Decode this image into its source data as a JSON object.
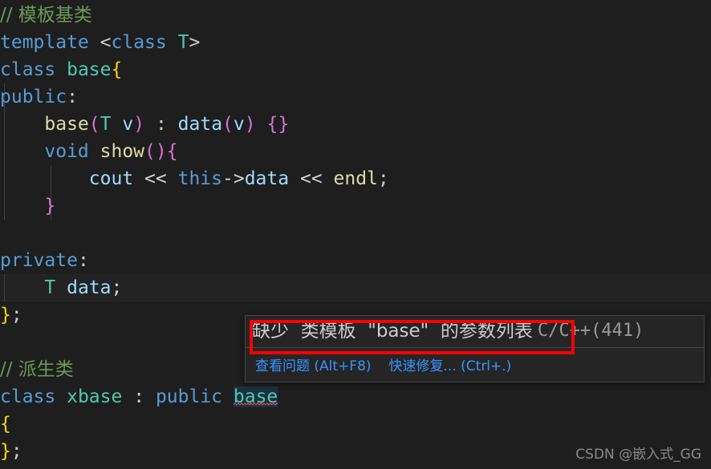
{
  "editor": {
    "background": "#1e1e1e",
    "font_size_px": 23,
    "line_height_px": 34,
    "code_lines": [
      {
        "n": 1,
        "text": "// 模板基类"
      },
      {
        "n": 2,
        "text": "template <class T>"
      },
      {
        "n": 3,
        "text": "class base{"
      },
      {
        "n": 4,
        "text": "public:"
      },
      {
        "n": 5,
        "text": "    base(T v) : data(v) {}"
      },
      {
        "n": 6,
        "text": "    void show(){"
      },
      {
        "n": 7,
        "text": "        cout << this->data << endl;"
      },
      {
        "n": 8,
        "text": "    }"
      },
      {
        "n": 9,
        "text": ""
      },
      {
        "n": 10,
        "text": "private:"
      },
      {
        "n": 11,
        "text": "    T data;"
      },
      {
        "n": 12,
        "text": "};"
      },
      {
        "n": 13,
        "text": ""
      },
      {
        "n": 14,
        "text": "// 派生类"
      },
      {
        "n": 15,
        "text": "class xbase : public base"
      },
      {
        "n": 16,
        "text": "{"
      },
      {
        "n": 17,
        "text": "};"
      }
    ],
    "tokens": {
      "comment_1": "// 模板基类",
      "comment_2": "// 派生类",
      "kw_template": "template",
      "kw_class": "class",
      "kw_public": "public",
      "kw_private": "private",
      "kw_void": "void",
      "kw_this": "this",
      "type_T": "T",
      "type_base": "base",
      "type_xbase": "xbase",
      "fn_base": "base",
      "fn_show": "show",
      "var_v": "v",
      "var_data": "data",
      "var_cout": "cout",
      "var_endl": "endl",
      "op_shift": "<<",
      "op_arrow": "->"
    },
    "colors": {
      "background": "#1e1e1e",
      "foreground": "#d4d4d4",
      "comment": "#6A9955",
      "keyword": "#569cd6",
      "type": "#4ec9b0",
      "function": "#dcdcaa",
      "variable": "#9cdcfe",
      "bracket_yellow": "#ffd700",
      "bracket_pink": "#da70d6",
      "bracket_blue": "#179fff",
      "error_squiggle": "#f14c4c",
      "occurrence_highlight": "#1d3040",
      "annotation_red": "#ff0000"
    },
    "error_symbol": "base"
  },
  "tooltip": {
    "message": "缺少  类模板  \"base\"  的参数列表",
    "source_code": "C/C++(441)",
    "actions": [
      {
        "label": "查看问题 (Alt+F8)"
      },
      {
        "label": "快速修复... (Ctrl+.)"
      }
    ]
  },
  "watermark": {
    "text": "CSDN @嵌入式_GG"
  }
}
